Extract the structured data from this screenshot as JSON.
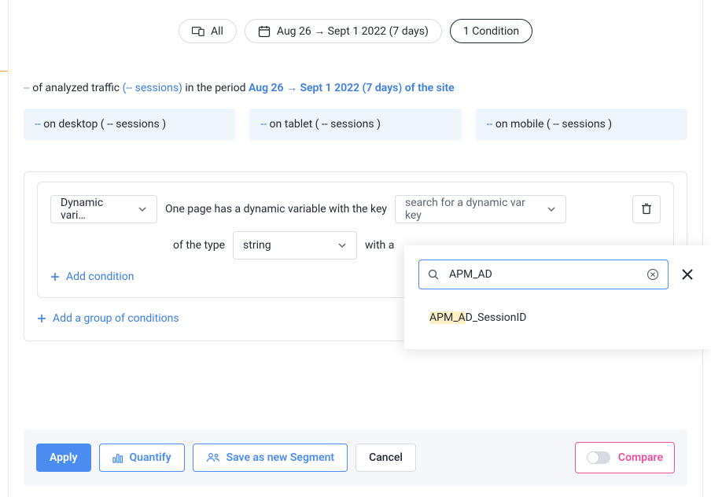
{
  "top": {
    "device_label": "All",
    "date_label": "Aug 26 → Sept 1 2022 (7 days)",
    "condition_label": "1 Condition"
  },
  "summary": {
    "prefix_dash": "--",
    "text1": " of analyzed traffic ",
    "sessions_link": "(-- sessions)",
    "text2": " in the period ",
    "period_link": "Aug 26 → Sept 1 2022 (7 days) of the site"
  },
  "chips": {
    "desktop": {
      "dash": "-- ",
      "text": "on desktop ( -- sessions )"
    },
    "tablet": {
      "dash": "-- ",
      "text": "on tablet ( -- sessions )"
    },
    "mobile": {
      "dash": "-- ",
      "text": "on mobile ( -- sessions )"
    }
  },
  "condition": {
    "variable_select": "Dynamic vari…",
    "sentence1": "One page has a dynamic variable with the key",
    "key_select": "search for a dynamic var key",
    "sentence2_a": "of the type",
    "type_select": "string",
    "sentence2_b": "with a",
    "add_condition": "Add condition",
    "add_group": "Add a group of conditions"
  },
  "dropdown": {
    "search_value": "APM_AD",
    "result_prefix": "APM_A",
    "result_suffix": "D_SessionID"
  },
  "footer": {
    "apply": "Apply",
    "quantify": "Quantify",
    "save": "Save as new Segment",
    "cancel": "Cancel",
    "compare": "Compare"
  }
}
